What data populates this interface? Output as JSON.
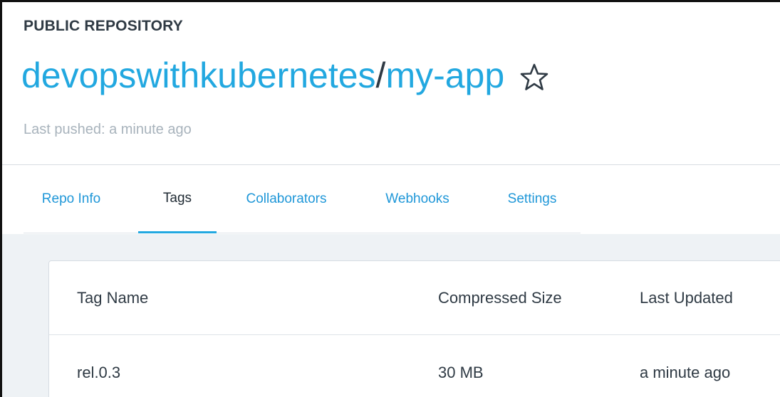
{
  "header": {
    "repo_type": "PUBLIC REPOSITORY",
    "owner": "devopswithkubernetes",
    "separator": "/",
    "name": "my-app",
    "last_pushed": "Last pushed: a minute ago",
    "star_icon": "star-outline-icon"
  },
  "tabs": [
    {
      "label": "Repo Info",
      "active": false
    },
    {
      "label": "Tags",
      "active": true
    },
    {
      "label": "Collaborators",
      "active": false
    },
    {
      "label": "Webhooks",
      "active": false
    },
    {
      "label": "Settings",
      "active": false
    }
  ],
  "table": {
    "columns": [
      "Tag Name",
      "Compressed Size",
      "Last Updated"
    ],
    "rows": [
      {
        "tag": "rel.0.3",
        "size": "30 MB",
        "updated": "a minute ago"
      }
    ]
  },
  "colors": {
    "accent": "#22a8e0",
    "text_dark": "#2f3a44",
    "text_muted": "#a8b3bc",
    "content_bg": "#eef2f5"
  }
}
